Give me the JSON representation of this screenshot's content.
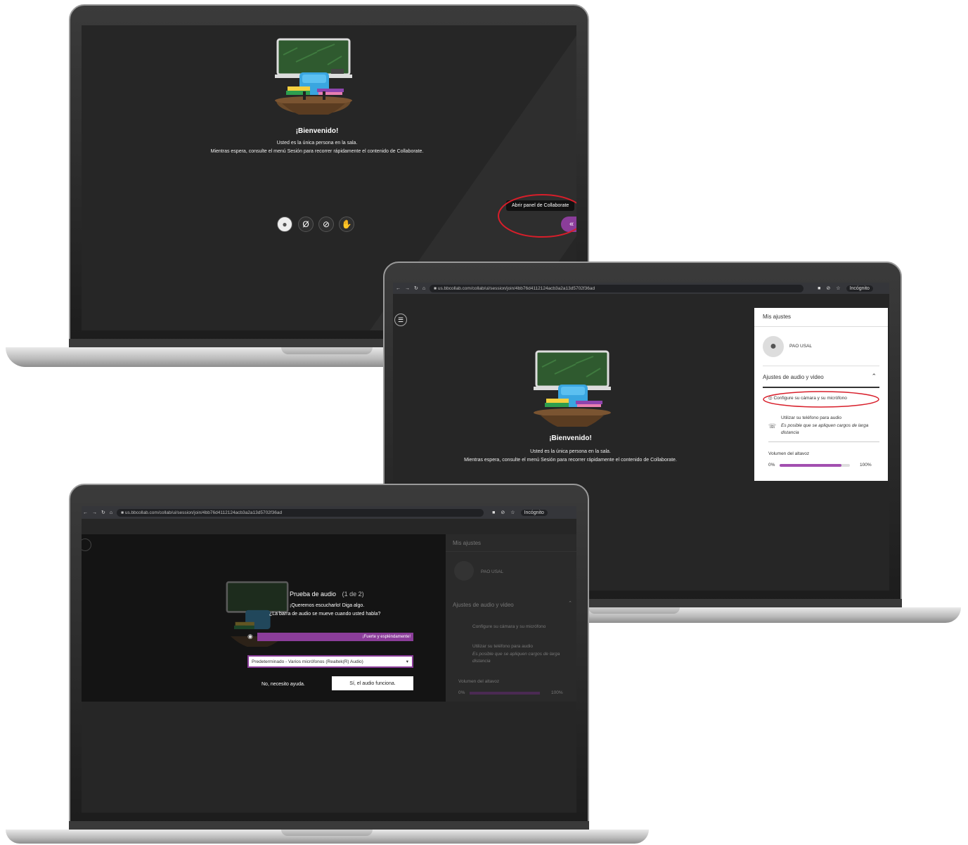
{
  "collab": {
    "welcome": "¡Bienvenido!",
    "only_person": "Usted es la única persona en la sala.",
    "while_waiting": "Mientras espera, consulte el menú Sesión para recorrer rápidamente el contenido de Collaborate.",
    "open_panel_tooltip": "Abrir panel de Collaborate"
  },
  "browser": {
    "url_top": "us.bbcollab.com/collab/ui/session/join/4bb76d4112124acb3a2a13d5702f36ad",
    "url_bottom": "us.bbcollab.com/collab/ui/session/join/4bb76d4112124acb3a2a13d5702f36ad",
    "incognito": "Incógnito"
  },
  "settings_panel": {
    "title": "Mis ajustes",
    "user_name": "PAO USAL",
    "section_audio_video": "Ajustes de audio y video",
    "configure_camera_mic": "Configure su cámara y su micrófono",
    "use_phone": "Utilizar su teléfono para audio",
    "phone_note": "Es posible que se apliquen cargos de larga distancia",
    "speaker_volume": "Volumen del altavoz",
    "vol_min": "0%",
    "vol_max": "100%",
    "volume_level": 0.88
  },
  "audio_test": {
    "title": "Prueba de audio",
    "step": "(1 de 2)",
    "line1": "¡Queremos escucharlo! Diga algo.",
    "line2": "¿La barra de audio se mueve cuando usted habla?",
    "level_text": "¡Fuerte y espléndamente!",
    "mic_select": "Predeterminado - Varios micrófonos (Realtek(R) Audio)",
    "btn_no": "No, necesito ayuda.",
    "btn_yes": "Sí, el audio funciona."
  },
  "colors": {
    "accent": "#8b3d9a",
    "annotation": "#d81e2a",
    "screen_bg": "#262626"
  }
}
